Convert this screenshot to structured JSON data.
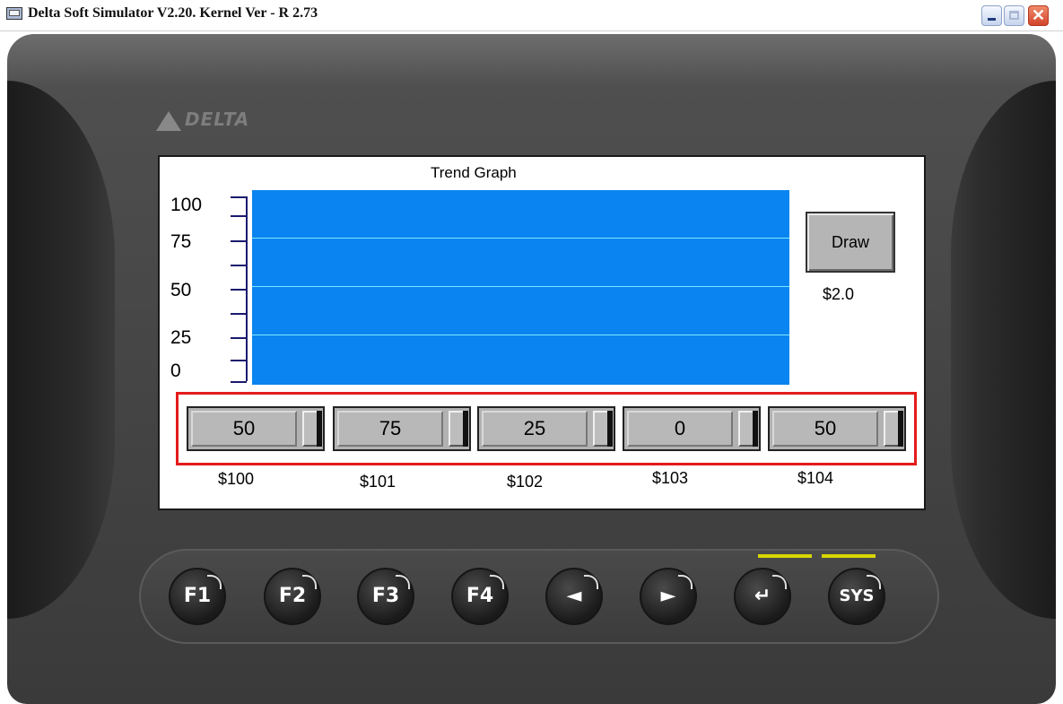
{
  "window": {
    "title": "Delta Soft Simulator V2.20. Kernel Ver - R 2.73",
    "controls": {
      "minimize": "minimize",
      "maximize": "maximize",
      "close": "✕"
    }
  },
  "brand": {
    "logo_text": "DELTA"
  },
  "trend_graph": {
    "title": "Trend Graph",
    "y_labels": [
      "100",
      "75",
      "50",
      "25",
      "0"
    ],
    "plot_color": "#0a84f0",
    "grid_color": "#7fe6ff"
  },
  "draw": {
    "label": "Draw",
    "address": "$2.0"
  },
  "sliders": [
    {
      "value": "50",
      "address": "$100"
    },
    {
      "value": "75",
      "address": "$101"
    },
    {
      "value": "25",
      "address": "$102"
    },
    {
      "value": "0",
      "address": "$103"
    },
    {
      "value": "50",
      "address": "$104"
    }
  ],
  "highlight_color": "#e41b1b",
  "keys": [
    "F1",
    "F2",
    "F3",
    "F4",
    "◄",
    "►",
    "↵",
    "SYS"
  ],
  "led_color": "#d7d600"
}
